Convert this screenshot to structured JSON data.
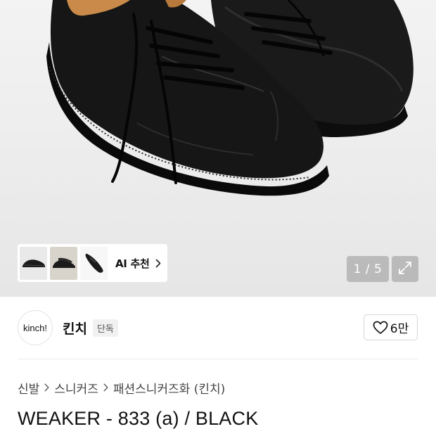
{
  "hero": {
    "image_alt": "black leather sneakers",
    "counter": "1 / 5",
    "expand_icon": "expand-icon"
  },
  "ai_recommend": {
    "label": "AI 추천",
    "chevron_icon": "chevron-right-icon",
    "thumbnails": [
      "shoe-thumbnail-1",
      "shoe-thumbnail-2",
      "shoe-thumbnail-3"
    ]
  },
  "brand": {
    "logo_text": "kinch!",
    "name": "킨치",
    "badge": "단독",
    "like_count": "6만",
    "like_icon": "heart-icon"
  },
  "breadcrumb": {
    "items": [
      "신발",
      "스니커즈",
      "패션스니커즈화 (킨치)"
    ]
  },
  "product": {
    "title": "WEAKER - 833 (a) / BLACK"
  }
}
